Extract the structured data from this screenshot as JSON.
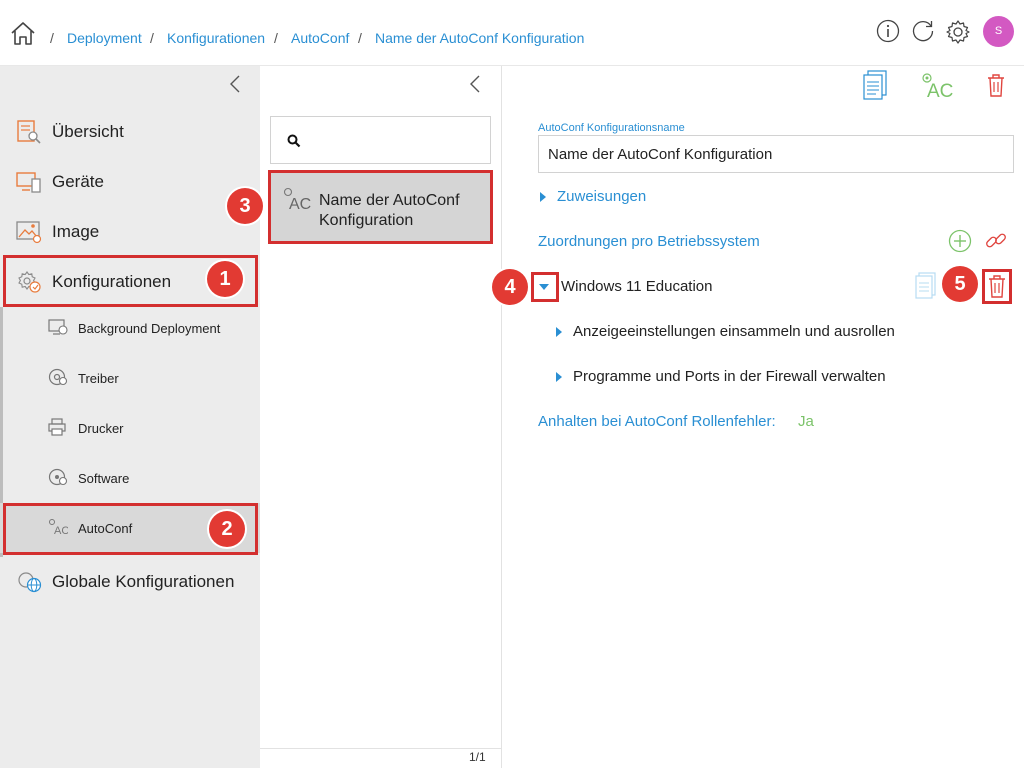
{
  "breadcrumb": {
    "items": [
      "Deployment",
      "Konfigurationen",
      "AutoConf",
      "Name der AutoConf Konfiguration"
    ],
    "separator": "/"
  },
  "header": {
    "avatar_initial": "S",
    "icons": [
      "home-icon",
      "info-icon",
      "refresh-icon",
      "settings-icon"
    ]
  },
  "sidebar": {
    "items": [
      {
        "label": "Übersicht",
        "icon": "overview-icon"
      },
      {
        "label": "Geräte",
        "icon": "devices-icon"
      },
      {
        "label": "Image",
        "icon": "image-icon"
      },
      {
        "label": "Konfigurationen",
        "icon": "gear-icon"
      },
      {
        "label": "Globale Konfigurationen",
        "icon": "globe-gear-icon"
      }
    ],
    "subitems": [
      {
        "label": "Background Deployment"
      },
      {
        "label": "Treiber"
      },
      {
        "label": "Drucker"
      },
      {
        "label": "Software"
      },
      {
        "label": "AutoConf"
      }
    ]
  },
  "list": {
    "search_placeholder": "",
    "items": [
      {
        "label": "Name der AutoConf Konfiguration",
        "icon_text": "AC"
      }
    ],
    "pager": "1/1"
  },
  "toolbar": {
    "ac_text": "AC"
  },
  "detail": {
    "name_label": "AutoConf Konfigurationsname",
    "name_value": "Name der AutoConf Konfiguration",
    "assignments": "Zuweisungen",
    "mapping_title": "Zuordnungen pro Betriebssystem",
    "os": "Windows 11 Education",
    "roles": [
      "Anzeigeeinstellungen einsammeln und ausrollen",
      "Programme und Ports in der Firewall verwalten"
    ],
    "halt_label": "Anhalten bei AutoConf Rollenfehler:",
    "halt_value": "Ja"
  },
  "annotations": [
    "1",
    "2",
    "3",
    "4",
    "5"
  ],
  "colors": {
    "accent": "#2a8fd3",
    "highlight": "#d32f2f",
    "badge": "#e23a33",
    "avatar": "#d359c2",
    "green": "#7cc36a",
    "delete": "#e0453f"
  }
}
